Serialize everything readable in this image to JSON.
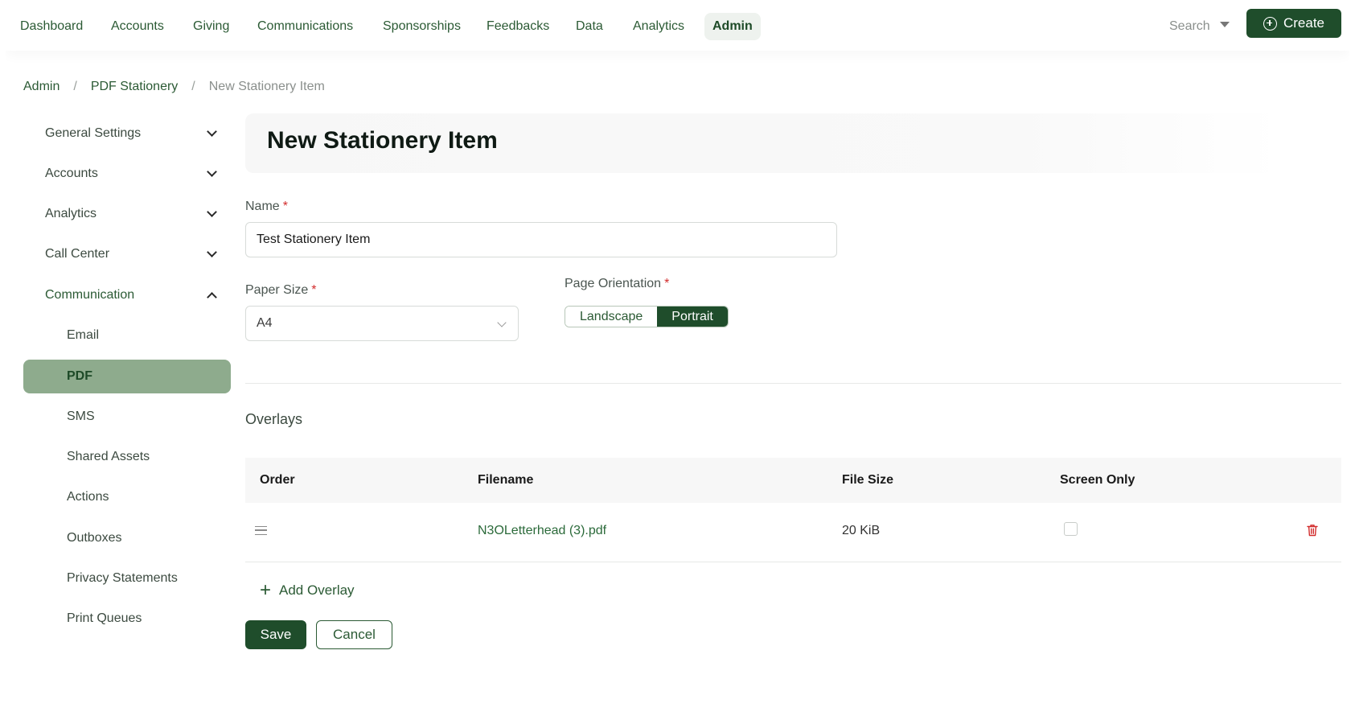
{
  "nav": {
    "items": [
      {
        "label": "Dashboard"
      },
      {
        "label": "Accounts"
      },
      {
        "label": "Giving"
      },
      {
        "label": "Communications"
      },
      {
        "label": "Sponsorships"
      },
      {
        "label": "Feedbacks"
      },
      {
        "label": "Data"
      },
      {
        "label": "Analytics"
      },
      {
        "label": "Admin",
        "active": true
      }
    ],
    "search_label": "Search",
    "create_label": "Create"
  },
  "breadcrumb": [
    "Admin",
    "PDF Stationery",
    "New Stationery Item"
  ],
  "sidebar": {
    "items": [
      {
        "label": "General Settings"
      },
      {
        "label": "Accounts"
      },
      {
        "label": "Analytics"
      },
      {
        "label": "Call Center"
      },
      {
        "label": "Communication",
        "expanded": true
      },
      {
        "label": "Email"
      },
      {
        "label": "PDF",
        "active": true
      },
      {
        "label": "SMS"
      },
      {
        "label": "Shared Assets"
      },
      {
        "label": "Actions"
      },
      {
        "label": "Outboxes"
      },
      {
        "label": "Privacy Statements"
      },
      {
        "label": "Print Queues"
      }
    ]
  },
  "page": {
    "title": "New Stationery Item"
  },
  "form": {
    "name_label": "Name",
    "name_value": "Test Stationery Item",
    "paper_size_label": "Paper Size",
    "paper_size_value": "A4",
    "orientation_label": "Page Orientation",
    "orientation_options": [
      "Landscape",
      "Portrait"
    ],
    "orientation_selected": "Portrait",
    "required_mark": "*"
  },
  "overlays": {
    "title": "Overlays",
    "columns": [
      "Order",
      "Filename",
      "File Size",
      "Screen Only"
    ],
    "rows": [
      {
        "filename": "N3OLetterhead (3).pdf",
        "file_size": "20 KiB",
        "screen_only": false
      }
    ],
    "add_label": "Add Overlay",
    "add_symbol": "+"
  },
  "actions": {
    "save_label": "Save",
    "cancel_label": "Cancel"
  },
  "colors": {
    "brand": "#1f4d2b",
    "active_sidebar": "#8eab8d",
    "required": "#d22c2c",
    "delete": "#d22c2c"
  }
}
